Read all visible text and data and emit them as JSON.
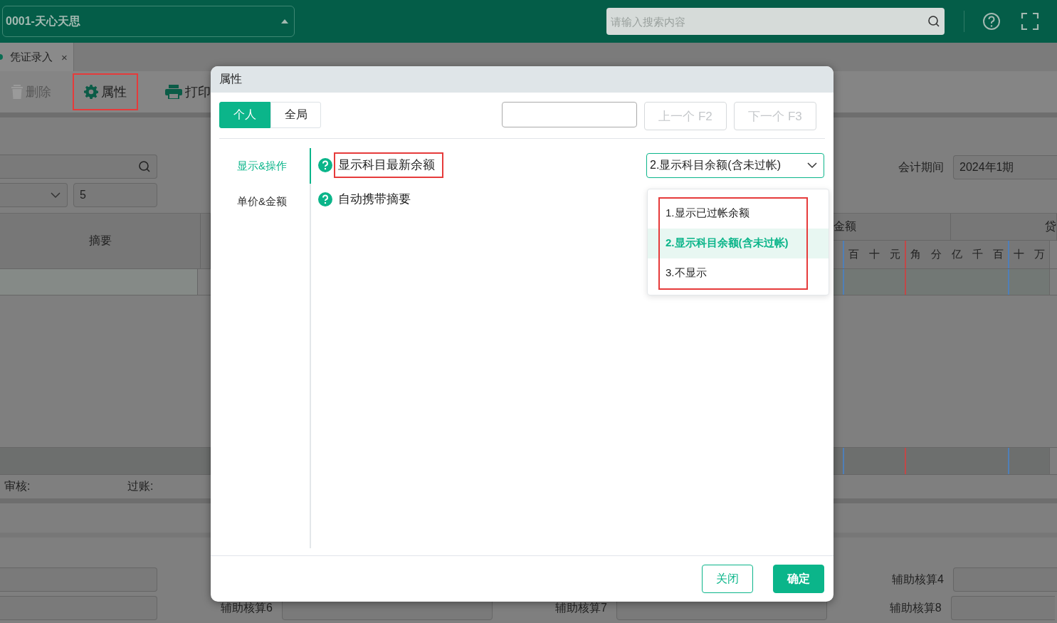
{
  "header": {
    "company": "0001-天心天思",
    "search_placeholder": "请输入搜索内容"
  },
  "tabs": [
    {
      "label": "凭证录入",
      "selected": true,
      "close": "×"
    }
  ],
  "toolbar": [
    {
      "label": "删除",
      "disabled": true,
      "highlighted": false
    },
    {
      "label": "属性",
      "disabled": false,
      "highlighted": true
    },
    {
      "label": "打印",
      "disabled": false,
      "highlighted": false
    }
  ],
  "voucher": {
    "number_value": "5",
    "period_label": "会计期间",
    "period_value": "2024年1期"
  },
  "table": {
    "summary_header": "摘要",
    "amount_header": "金额",
    "credit_header": "贷",
    "digits": [
      "百",
      "十",
      "元",
      "角",
      "分",
      "亿",
      "千",
      "百",
      "十",
      "万"
    ]
  },
  "signatures": [
    "审核:",
    "过账:"
  ],
  "aux": {
    "row_1": [
      "辅助核算4"
    ],
    "row_2": [
      "辅助核算6",
      "辅助核算7",
      "辅助核算8"
    ]
  },
  "dialog": {
    "title": "属性",
    "scopes": [
      {
        "label": "个人",
        "selected": true
      },
      {
        "label": "全局",
        "selected": false
      }
    ],
    "find_buttons": [
      {
        "label": "上一个 F2",
        "disabled": true
      },
      {
        "label": "下一个 F3",
        "disabled": true
      }
    ],
    "nav": [
      {
        "label": "显示&操作",
        "selected": true
      },
      {
        "label": "单价&金额",
        "selected": false
      }
    ],
    "settings": [
      {
        "kind": "select",
        "label": "显示科目最新余额",
        "highlighted": true,
        "value": "2.显示科目余额(含未过帐)",
        "expanded": true,
        "options_highlighted": true,
        "options": [
          {
            "label": "1.显示已过帐余额",
            "selected": false
          },
          {
            "label": "2.显示科目余额(含未过帐)",
            "selected": true
          },
          {
            "label": "3.不显示",
            "selected": false
          }
        ]
      },
      {
        "kind": "plain",
        "label": "自动携带摘要",
        "highlighted": false
      }
    ],
    "buttons": [
      {
        "label": "关闭",
        "kind": "secondary"
      },
      {
        "label": "确定",
        "kind": "primary"
      }
    ]
  }
}
